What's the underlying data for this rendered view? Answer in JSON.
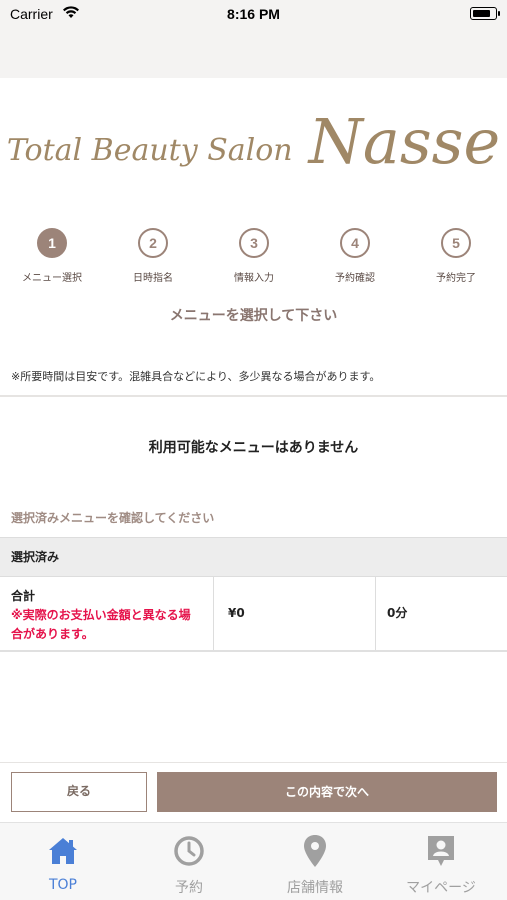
{
  "status_bar": {
    "carrier": "Carrier",
    "time": "8:16 PM"
  },
  "logo": {
    "tagline": "Total Beauty Salon",
    "name": "Nasse"
  },
  "steps": [
    {
      "number": "1",
      "label": "メニュー選択",
      "active": true
    },
    {
      "number": "2",
      "label": "日時指名",
      "active": false
    },
    {
      "number": "3",
      "label": "情報入力",
      "active": false
    },
    {
      "number": "4",
      "label": "予約確認",
      "active": false
    },
    {
      "number": "5",
      "label": "予約完了",
      "active": false
    }
  ],
  "main": {
    "heading": "メニューを選択して下さい",
    "notice": "※所要時間は目安です。混雑具合などにより、多少異なる場合があります。",
    "empty_message": "利用可能なメニューはありません",
    "confirm_label": "選択済みメニューを確認してください",
    "selected_header": "選択済み",
    "total": {
      "label": "合計",
      "note_line1": "※実際のお支払い金額と異なる場",
      "note_line2": "合があります。",
      "price": "¥0",
      "duration": "0分"
    }
  },
  "buttons": {
    "back": "戻る",
    "next": "この内容で次へ"
  },
  "tab_bar": [
    {
      "label": "TOP",
      "icon": "home-icon",
      "active": true
    },
    {
      "label": "予約",
      "icon": "clock-icon",
      "active": false
    },
    {
      "label": "店舗情報",
      "icon": "map-pin-icon",
      "active": false
    },
    {
      "label": "マイページ",
      "icon": "account-badge-icon",
      "active": false
    }
  ],
  "colors": {
    "brand_gold": "#a08866",
    "accent_taupe": "#9c8479",
    "warning_red": "#e5134b",
    "tab_active": "#4a7fd6",
    "tab_inactive": "#a0a0a0"
  }
}
